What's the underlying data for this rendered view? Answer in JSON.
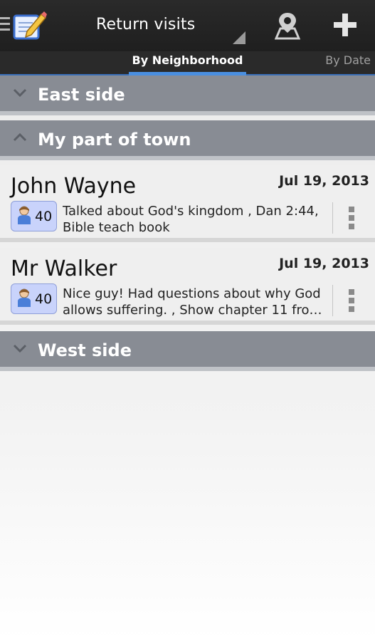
{
  "actionbar": {
    "title": "Return visits",
    "icons": [
      "menu-lines-icon",
      "app-notepad-icon",
      "spinner-dropdown-icon",
      "map-pin-icon",
      "add-icon"
    ]
  },
  "tabs": {
    "active": "By Neighborhood",
    "inactive": "By Date"
  },
  "groups": [
    {
      "label": "East side",
      "expanded": false
    },
    {
      "label": "My part of town",
      "expanded": true
    },
    {
      "label": "West side",
      "expanded": false
    }
  ],
  "visits": [
    {
      "name": "John Wayne",
      "date": "Jul 19, 2013",
      "count": "40",
      "notes": "Talked about God's kingdom , Dan 2:44, Bible teach book"
    },
    {
      "name": "Mr Walker",
      "date": "Jul 19, 2013",
      "count": "40",
      "notes": "Nice guy! Had questions about why God allows suffering. , Show chapter 11 fro…"
    }
  ],
  "colors": {
    "actionbar": "#222222",
    "tab_underline": "#4a8fe0",
    "group_header": "#888c94",
    "badge": "#c9d3fb"
  }
}
